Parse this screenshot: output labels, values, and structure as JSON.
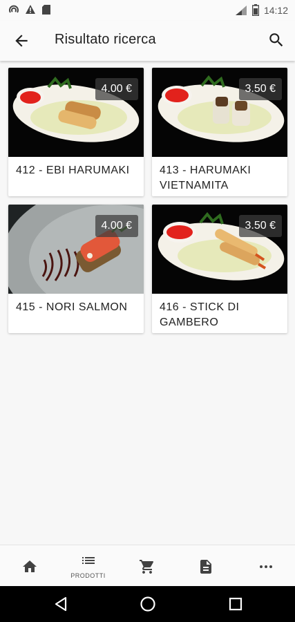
{
  "status_bar": {
    "time": "14:12",
    "left_icons": [
      "nfc-icon",
      "warning-icon",
      "sd-card-icon"
    ],
    "right_icons": [
      "signal-icon",
      "battery-icon"
    ]
  },
  "app_bar": {
    "title": "Risultato ricerca",
    "back_icon": "arrow-back-icon",
    "search_icon": "search-icon"
  },
  "products": [
    {
      "title": "412 - EBI HARUMAKI",
      "price": "4.00 €"
    },
    {
      "title": "413 - HARUMAKI VIETNAMITA",
      "price": "3.50 €"
    },
    {
      "title": "415 - NORI SALMON",
      "price": "4.00 €"
    },
    {
      "title": "416 - STICK DI GAMBERO",
      "price": "3.50 €"
    }
  ],
  "bottom_nav": {
    "items": [
      {
        "icon": "home-icon",
        "label": ""
      },
      {
        "icon": "list-icon",
        "label": "PRODOTTI"
      },
      {
        "icon": "cart-icon",
        "label": ""
      },
      {
        "icon": "document-icon",
        "label": ""
      },
      {
        "icon": "more-icon",
        "label": ""
      }
    ]
  },
  "system_nav": [
    "back-triangle-icon",
    "home-circle-icon",
    "recents-square-icon"
  ]
}
